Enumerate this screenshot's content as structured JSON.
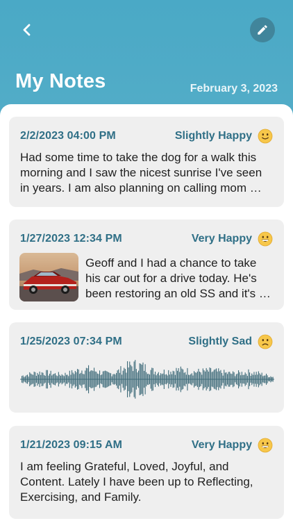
{
  "header": {
    "title": "My Notes",
    "date": "February 3, 2023",
    "back_icon": "chevron-left-icon",
    "edit_icon": "pencil-icon"
  },
  "colors": {
    "header_top": "#4aa9c6",
    "accent_text": "#2f6f86",
    "card_bg": "#efefef",
    "edit_button_bg": "#41859b",
    "emoji_yellow": "#f7c74a",
    "waveform": "#3d6a78"
  },
  "notes": [
    {
      "timestamp": "2/2/2023  04:00 PM",
      "mood": "Slightly Happy",
      "mood_icon": "slightly-smiling-face-icon",
      "text": "Had some time to take the dog for a walk this morning and I saw the nicest sunrise I've seen in years.  I am also planning on calling mom …"
    },
    {
      "timestamp": "1/27/2023  12:34 PM",
      "mood": "Very Happy",
      "mood_icon": "grinning-face-icon",
      "image": "red-muscle-car-photo",
      "text": "Geoff and I had a chance to take his car out for a drive today.  He's been restoring an old SS and it's …"
    },
    {
      "timestamp": "1/25/2023  07:34 PM",
      "mood": "Slightly Sad",
      "mood_icon": "slightly-frowning-face-icon",
      "attachment": "audio-waveform"
    },
    {
      "timestamp": "1/21/2023  09:15 AM",
      "mood": "Very Happy",
      "mood_icon": "grinning-face-icon",
      "text": "I am feeling Grateful, Loved, Joyful, and Content.  Lately I have been up to Reflecting, Exercising, and Family."
    }
  ]
}
